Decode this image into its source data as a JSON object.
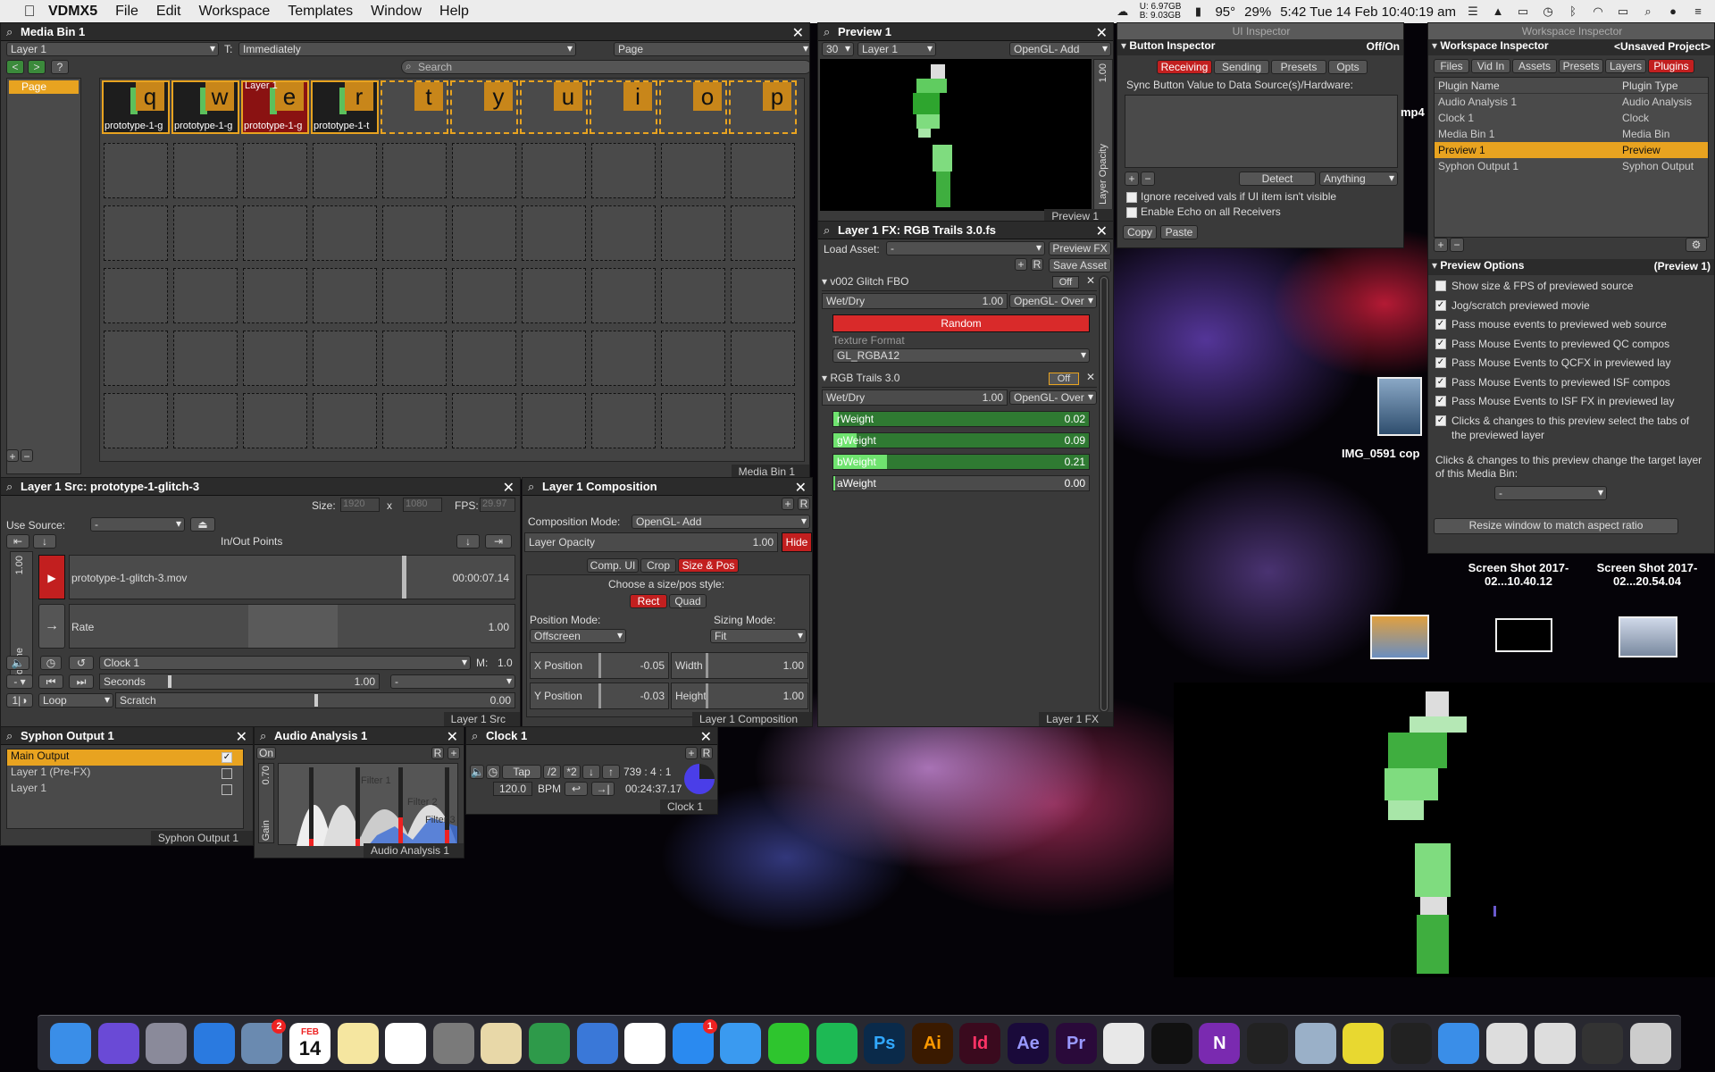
{
  "menubar": {
    "app": "VDMX5",
    "items": [
      "File",
      "Edit",
      "Workspace",
      "Templates",
      "Window",
      "Help"
    ],
    "mem": "U: 6.97GB\nB: 9.03GB",
    "temp": "95°",
    "battery": "29%",
    "datetime": "5:42 Tue 14 Feb 10:40:19 am"
  },
  "media_bin": {
    "title": "Media Bin 1",
    "layer": "Layer 1",
    "t_label": "T:",
    "trigger": "Immediately",
    "page": "Page",
    "search": "Search",
    "page_list": [
      "Page"
    ],
    "keys": [
      "q",
      "w",
      "e",
      "r",
      "t",
      "y",
      "u",
      "i",
      "o",
      "p"
    ],
    "clip_names": [
      "prototype-1-g",
      "prototype-1-g",
      "prototype-1-g",
      "prototype-1-t"
    ],
    "active_layer_badge": "Layer 1",
    "footer": "Media Bin 1",
    "nav": [
      "<",
      ">",
      "?"
    ]
  },
  "layer_src": {
    "title": "Layer 1 Src: prototype-1-glitch-3",
    "size_label": "Size:",
    "w": "1920",
    "x": "x",
    "h": "1080",
    "fps_label": "FPS:",
    "fps": "29.97",
    "use_source": "Use Source:",
    "source": "-",
    "inout": "In/Out Points",
    "volume_val": "1.00",
    "volume_label": "Volume",
    "file": "prototype-1-glitch-3.mov",
    "time": "00:00:07.14",
    "rate_label": "Rate",
    "rate": "1.00",
    "clock": "Clock 1",
    "m_label": "M:",
    "m": "1.0",
    "seconds": "Seconds",
    "seconds_val": "1.00",
    "dash": "-",
    "loop": "Loop",
    "scratch": "Scratch",
    "scratch_val": "0.00",
    "footer": "Layer 1 Src"
  },
  "composition": {
    "title": "Layer 1 Composition",
    "mode_label": "Composition Mode:",
    "mode": "OpenGL- Add",
    "opacity_label": "Layer Opacity",
    "opacity": "1.00",
    "hide": "Hide",
    "tabs": [
      "Comp. UI",
      "Crop",
      "Size & Pos"
    ],
    "choose": "Choose a size/pos style:",
    "rect": "Rect",
    "quad": "Quad",
    "pos_mode_label": "Position Mode:",
    "pos_mode": "Offscreen",
    "sizing_label": "Sizing Mode:",
    "sizing": "Fit",
    "x_label": "X Position",
    "x": "-0.05",
    "w_label": "Width",
    "w": "1.00",
    "y_label": "Y Position",
    "y": "-0.03",
    "h_label": "Height",
    "h": "1.00",
    "footer": "Layer 1 Composition"
  },
  "preview": {
    "title": "Preview 1",
    "fps": "30",
    "layer": "Layer 1",
    "blend": "OpenGL- Add",
    "opacity_val": "1.00",
    "opacity_label": "Layer Opacity",
    "footer": "Preview 1"
  },
  "fx": {
    "title": "Layer 1 FX: RGB Trails 3.0.fs",
    "load_label": "Load Asset:",
    "load": "-",
    "preview_fx": "Preview FX",
    "save_asset": "Save Asset",
    "fx1_name": "v002 Glitch FBO",
    "fx1_state": "Off",
    "wetdry": "Wet/Dry",
    "wetdry_val": "1.00",
    "blend": "OpenGL- Over",
    "random": "Random",
    "tex_label": "Texture Format",
    "tex": "GL_RGBA12",
    "fx2_name": "RGB Trails 3.0",
    "fx2_state": "Off",
    "params": [
      {
        "label": "rWeight",
        "value": "0.02",
        "level": 0.02
      },
      {
        "label": "gWeight",
        "value": "0.09",
        "level": 0.09
      },
      {
        "label": "bWeight",
        "value": "0.21",
        "level": 0.21
      },
      {
        "label": "aWeight",
        "value": "0.00",
        "level": 0.0
      }
    ],
    "footer": "Layer 1 FX"
  },
  "ui_inspector": {
    "title": "UI Inspector",
    "sub": "Button Inspector",
    "offon": "Off/On",
    "tabs": [
      "Receiving",
      "Sending",
      "Presets",
      "Opts"
    ],
    "sync": "Sync Button Value to Data Source(s)/Hardware:",
    "detect": "Detect",
    "anything": "Anything",
    "opt1": "Ignore received vals if UI item isn't visible",
    "opt2": "Enable Echo on all Receivers",
    "copy": "Copy",
    "paste": "Paste"
  },
  "ws_inspector": {
    "title": "Workspace Inspector",
    "sub": "Workspace Inspector",
    "project": "<Unsaved Project>",
    "tabs": [
      "Files",
      "Vid In",
      "Assets",
      "Presets",
      "Layers",
      "Plugins"
    ],
    "col1": "Plugin Name",
    "col2": "Plugin Type",
    "rows": [
      {
        "name": "Audio Analysis 1",
        "type": "Audio Analysis"
      },
      {
        "name": "Clock 1",
        "type": "Clock"
      },
      {
        "name": "Media Bin 1",
        "type": "Media Bin"
      },
      {
        "name": "Preview 1",
        "type": "Preview"
      },
      {
        "name": "Syphon Output 1",
        "type": "Syphon Output"
      }
    ],
    "opts_title": "Preview Options",
    "opts_target": "(Preview 1)",
    "opts": [
      "Show size & FPS of previewed source",
      "Jog/scratch previewed movie",
      "Pass mouse events to previewed web source",
      "Pass Mouse Events to previewed QC compos",
      "Pass Mouse Events to QCFX in previewed lay",
      "Pass Mouse Events to previewed ISF compos",
      "Pass Mouse Events to ISF FX in previewed lay",
      "Clicks & changes to this preview select the tabs of the previewed layer"
    ],
    "change_text": "Clicks & changes to this preview change the target layer of this Media Bin:",
    "target": "-",
    "resize": "Resize window to match aspect ratio"
  },
  "syphon": {
    "title": "Syphon Output 1",
    "items": [
      "Main Output",
      "Layer 1 (Pre-FX)",
      "Layer 1"
    ],
    "footer": "Syphon Output 1"
  },
  "audio": {
    "title": "Audio Analysis 1",
    "on": "On",
    "gain_val": "0.70",
    "gain": "Gain",
    "filters": [
      "Filter 1",
      "Filter 2",
      "Filter 3"
    ],
    "footer": "Audio Analysis 1"
  },
  "clock": {
    "title": "Clock 1",
    "tap": "Tap",
    "div2": "/2",
    "mul2": "*2",
    "bar": "739 : 4 : 1",
    "bpm": "120.0",
    "bpm_label": "BPM",
    "time": "00:24:37.17",
    "footer": "Clock 1"
  },
  "desktop": {
    "files": [
      "mp4",
      "IMG_0591 cop",
      "Screen Shot 2017-02...10.40.12",
      "Screen Shot 2017-02...20.54.04"
    ]
  },
  "dock": {
    "items": [
      "Finder",
      "Siri",
      "Launchpad",
      "Safari",
      "Mail",
      "Calendar",
      "Notes",
      "Photos",
      "System Preferences",
      "TextEdit",
      "Numbers",
      "Keynote",
      "iTunes",
      "App Store",
      "Messages",
      "WeChat",
      "Spotify",
      "Photoshop",
      "Illustrator",
      "InDesign",
      "After Effects",
      "Premiere",
      "Screenflick",
      "Logic",
      "OneNote",
      "VDMX Jump",
      "Preview",
      "VDMX",
      "Activity Monitor",
      "Downloads",
      "Stacks",
      "Documents",
      "Stack",
      "Trash"
    ],
    "calendar_month": "FEB",
    "calendar_day": "14",
    "mail_badge": "2",
    "appstore_badge": "1",
    "ps": "Ps",
    "ai": "Ai",
    "id": "Id",
    "ae": "Ae",
    "pr": "Pr",
    "on": "N"
  }
}
